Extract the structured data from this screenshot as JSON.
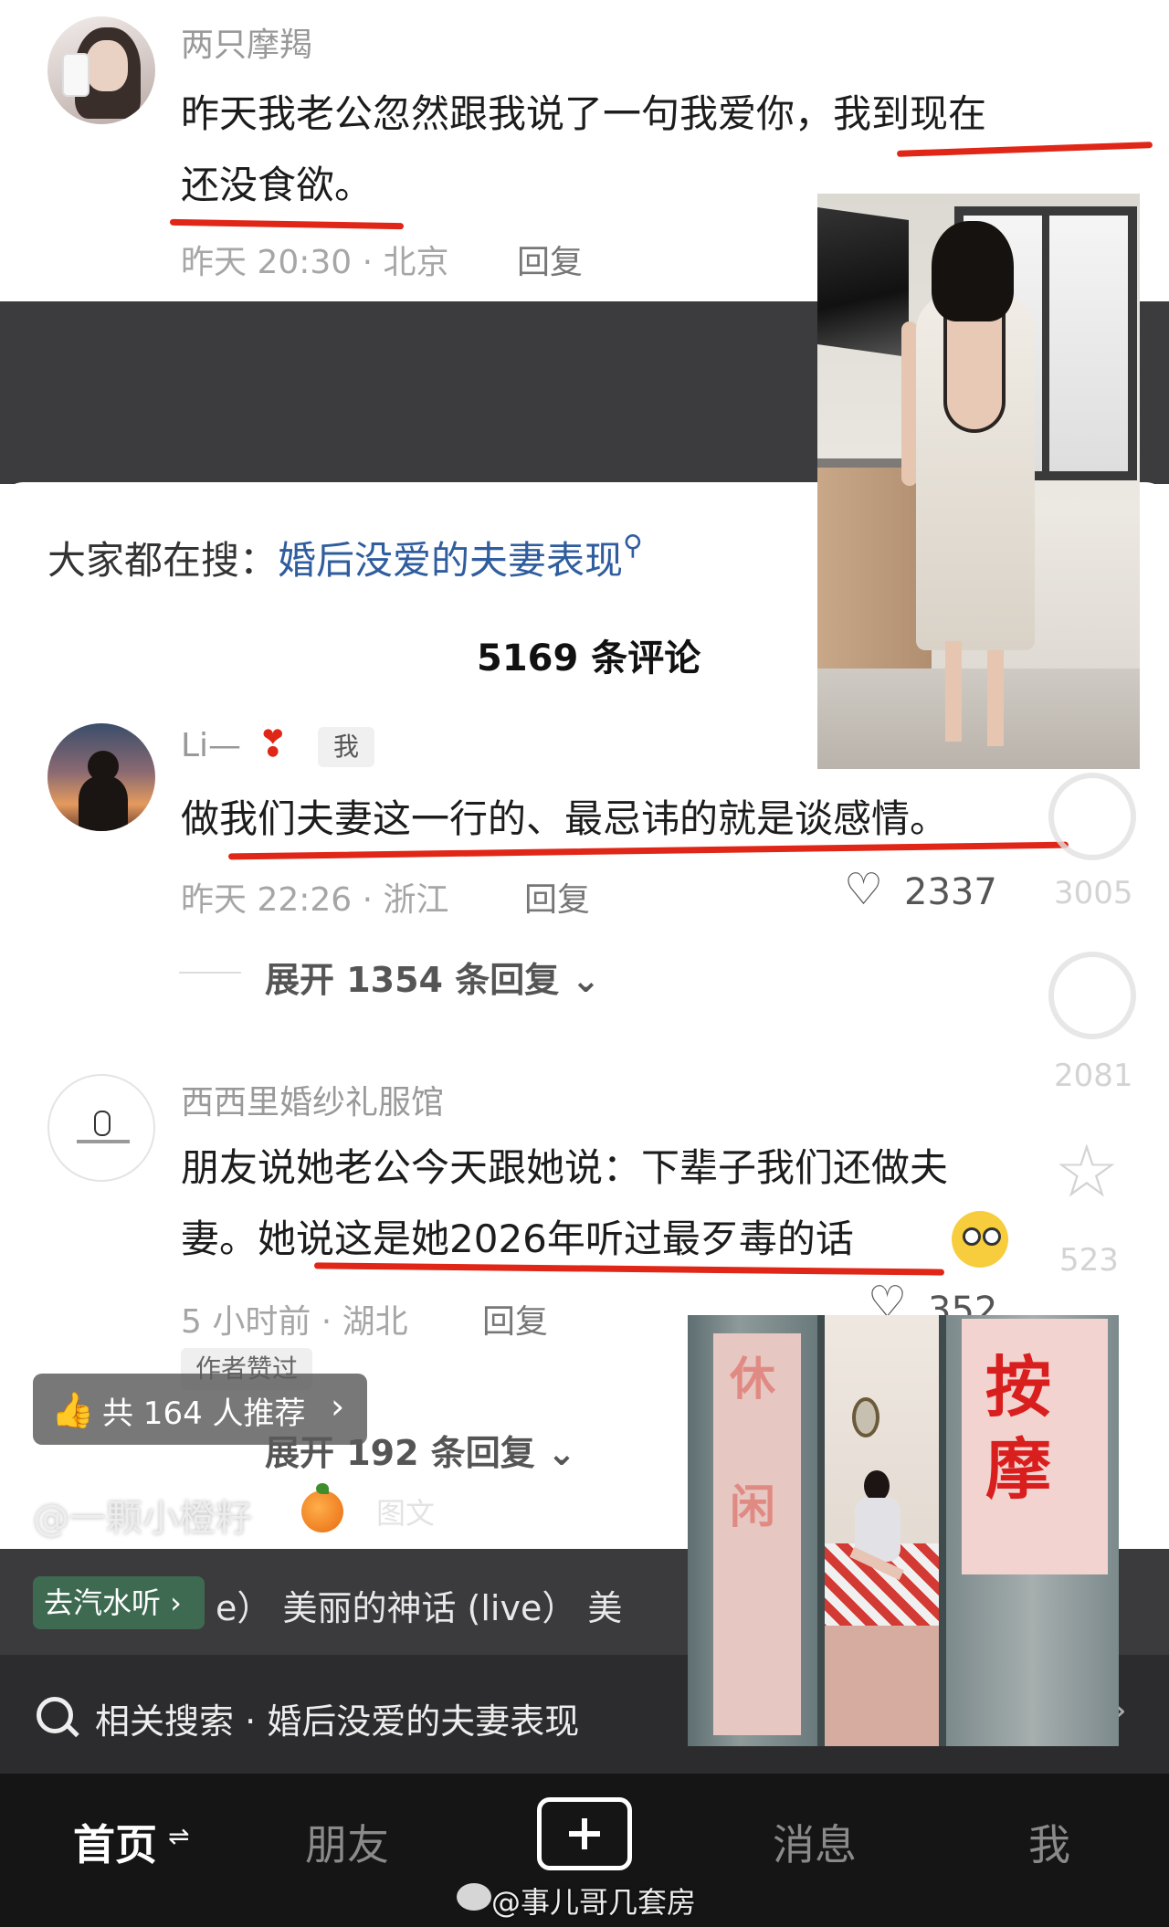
{
  "post1": {
    "username": "两只摩羯",
    "text_line1_a": "昨天我老公忽然跟我说了一句我爱你，",
    "text_line1_b": "我到现在",
    "text_line2": "还没食欲。",
    "time_location": "昨天 20:30 · 北京",
    "reply_label": "回复"
  },
  "sheet": {
    "search_prefix": "大家都在搜：",
    "search_term": "婚后没爱的夫妻表现",
    "comment_count": "5169 条评论"
  },
  "comment1": {
    "username": "Li—",
    "badge": "我",
    "text": "做我们夫妻这一行的、最忌讳的就是谈感情。",
    "time_location": "昨天 22:26 · 浙江",
    "reply_label": "回复",
    "likes": "2337",
    "expand": "展开 1354 条回复"
  },
  "comment2": {
    "username": "西西里婚纱礼服馆",
    "text_line1": "朋友说她老公今天跟她说：下辈子我们还做夫",
    "text_line2": "妻。她说这是她2026年听过最歹毒的话",
    "time_location": "5 小时前 · 湖北",
    "reply_label": "回复",
    "likes": "352",
    "author_liked": "作者赞过",
    "expand": "展开 192 条回复"
  },
  "side_counts": {
    "likes": "3005",
    "comments": "2081",
    "favorites": "523"
  },
  "room_sign": [
    "按",
    "摩"
  ],
  "room_sign_left": [
    "休",
    "闲"
  ],
  "recommend": "共 164 人推荐",
  "author_handle": "@一颗小橙籽",
  "tuwen": "图文",
  "music": {
    "button": "去汽水听 ›",
    "text": "e） 美丽的神话 (live） 美"
  },
  "related": {
    "prefix": "相关搜索 · ",
    "term": "婚后没爱的夫妻表现"
  },
  "nav": {
    "home": "首页",
    "friends": "朋友",
    "messages": "消息",
    "me": "我"
  },
  "watermark": "@事儿哥几套房"
}
